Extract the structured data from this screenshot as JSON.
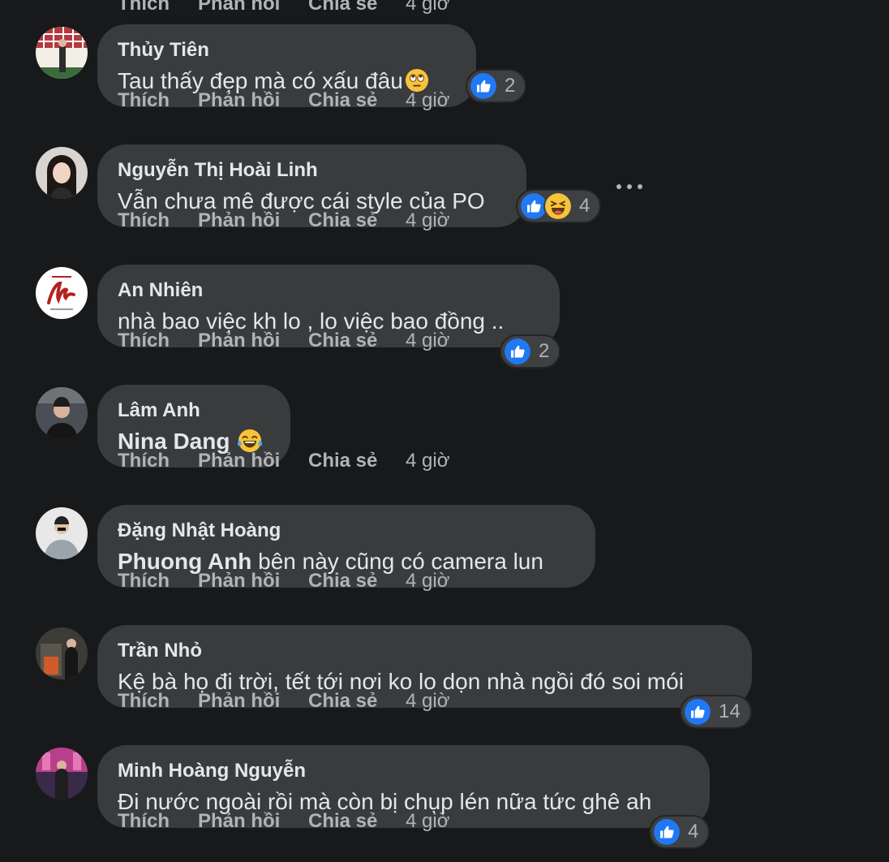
{
  "actions": {
    "like": "Thích",
    "reply": "Phản hồi",
    "share": "Chia sẻ",
    "time": "4 giờ"
  },
  "colors": {
    "background": "#18191a",
    "bubble": "#3a3b3c",
    "like_blue": "#2078f4",
    "action_text": "#b0b3b8"
  },
  "comments": [
    {
      "author": "Thủy Tiên",
      "text": "Tau thấy đẹp mà có xấu đâu",
      "text_emoji": "face-with-rolling-eyes",
      "reactions": [
        "like-icon"
      ],
      "reaction_count": "2"
    },
    {
      "author": "Nguyễn Thị Hoài Linh",
      "text": "Vẫn chưa mê được cái style của PO",
      "reactions": [
        "like-icon",
        "haha-icon"
      ],
      "reaction_count": "4",
      "more_options": "more-options-icon"
    },
    {
      "author": "An Nhiên",
      "text": "nhà bao việc kh lo , lo việc bao đồng ..",
      "reactions": [
        "like-icon"
      ],
      "reaction_count": "2"
    },
    {
      "author": "Lâm Anh",
      "mention": "Nina Dang",
      "text_emoji": "face-with-tears-of-joy"
    },
    {
      "author": "Đặng Nhật Hoàng",
      "mention": "Phuong Anh",
      "text": " bên này cũng có camera lun"
    },
    {
      "author": "Trần Nhỏ",
      "text": "Kệ bà họ đi trời, tết tới nơi ko lo dọn nhà ngồi đó soi mói",
      "reactions": [
        "like-icon"
      ],
      "reaction_count": "14"
    },
    {
      "author": "Minh Hoàng Nguyễn",
      "text": "Đi nước ngoài rồi mà còn bị chụp lén nữa tức ghê ah",
      "reactions": [
        "like-icon"
      ],
      "reaction_count": "4"
    }
  ]
}
